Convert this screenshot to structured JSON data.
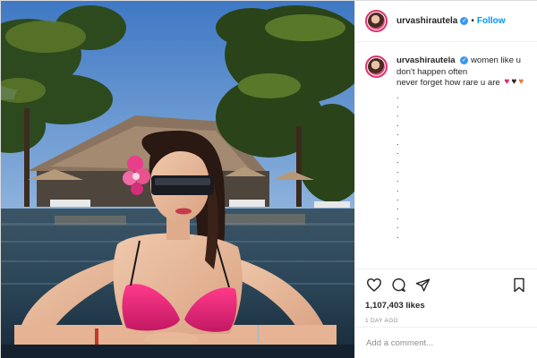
{
  "post": {
    "username": "urvashirautela",
    "verified_icon": "verified-badge-icon",
    "separator": "•",
    "follow_label": "Follow",
    "caption_lines": [
      "women like u don't happen often",
      "never forget how rare u are"
    ],
    "heart_icons": [
      "red-heart-icon",
      "black-heart-icon",
      "orange-heart-icon"
    ],
    "dot_lines": [
      ".",
      ".",
      ".",
      ".",
      ".",
      ".",
      ".",
      ".",
      ".",
      ".",
      ".",
      ".",
      ".",
      ".",
      ".",
      "."
    ],
    "likes": "1,107,403 likes",
    "time_ago": "1 DAY AGO",
    "comment_placeholder": "Add a comment...",
    "action_icons": [
      "heart-outline-icon",
      "comment-bubble-icon",
      "share-send-icon",
      "bookmark-icon"
    ]
  },
  "colors": {
    "link_blue": "#0095f6",
    "verified_blue": "#3897f0",
    "story_ring": "#e1306c",
    "text": "#262626",
    "muted": "#8e8e8e",
    "divider": "#efefef"
  }
}
